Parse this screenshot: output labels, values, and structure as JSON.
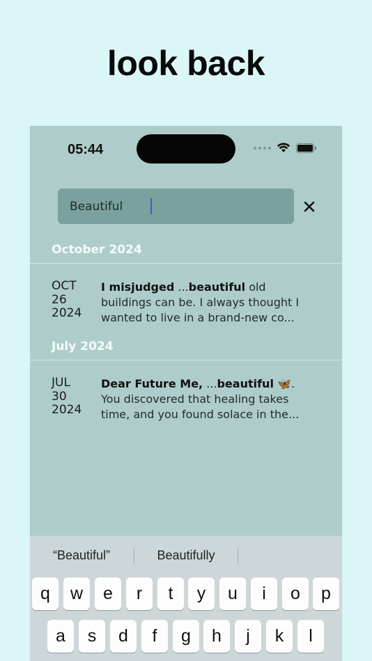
{
  "headline": "look back",
  "status_bar": {
    "time": "05:44"
  },
  "search": {
    "value": "Beautiful"
  },
  "sections": [
    {
      "heading": "October 2024",
      "entries": [
        {
          "date": "OCT\n26\n2024",
          "title": "I misjudged",
          "ellipsis_prefix": " ...",
          "match": "beautiful",
          "after_match": " old buildings can be. I always thought I wanted to live in a brand-new co..."
        }
      ]
    },
    {
      "heading": "July 2024",
      "entries": [
        {
          "date": "JUL\n30\n2024",
          "title": "Dear Future Me,",
          "ellipsis_prefix": " ...",
          "match": "beautiful",
          "emoji": "🦋",
          "after_match": ".",
          "preview": "You discovered that healing takes time, and you found solace in the..."
        }
      ]
    }
  ],
  "keyboard": {
    "suggestions": [
      "“Beautiful”",
      "Beautifully"
    ],
    "row1": [
      "q",
      "w",
      "e",
      "r",
      "t",
      "y",
      "u",
      "i",
      "o",
      "p"
    ],
    "row2": [
      "a",
      "s",
      "d",
      "f",
      "g",
      "h",
      "j",
      "k",
      "l"
    ]
  },
  "colors": {
    "background": "#dbf6f7",
    "phone": "#aecdca",
    "search": "#7aa19d",
    "caret": "#3b5bdb"
  }
}
